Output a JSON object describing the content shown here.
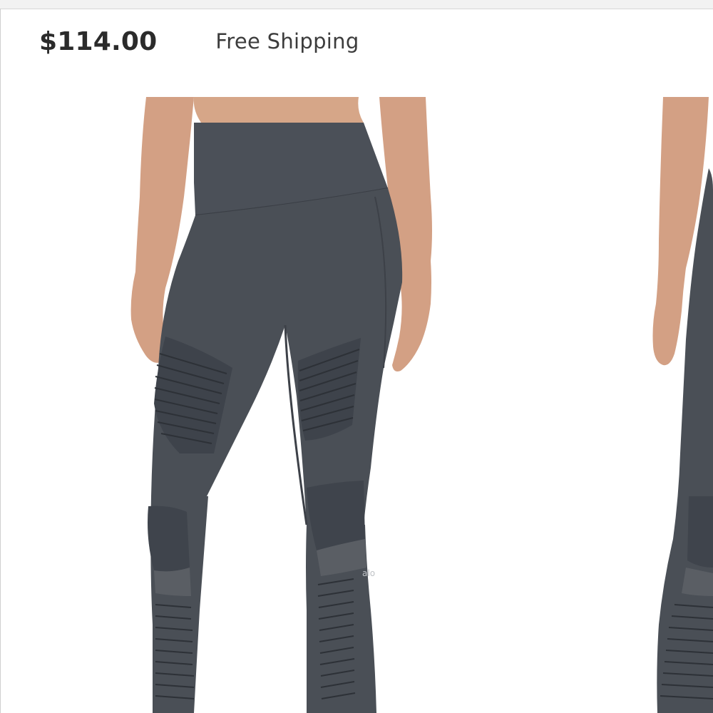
{
  "product": {
    "price": "$114.00",
    "shipping": "Free Shipping"
  },
  "gallery": {
    "main_image": {
      "subject": "leggings-photo",
      "brand_mark": "alo"
    },
    "next_image": {
      "subject": "leggings-photo-next"
    }
  },
  "colors": {
    "fabric": "#4a4f56",
    "fabric_dark": "#3a3e45",
    "skin": "#d9a88b",
    "background": "#ffffff"
  }
}
